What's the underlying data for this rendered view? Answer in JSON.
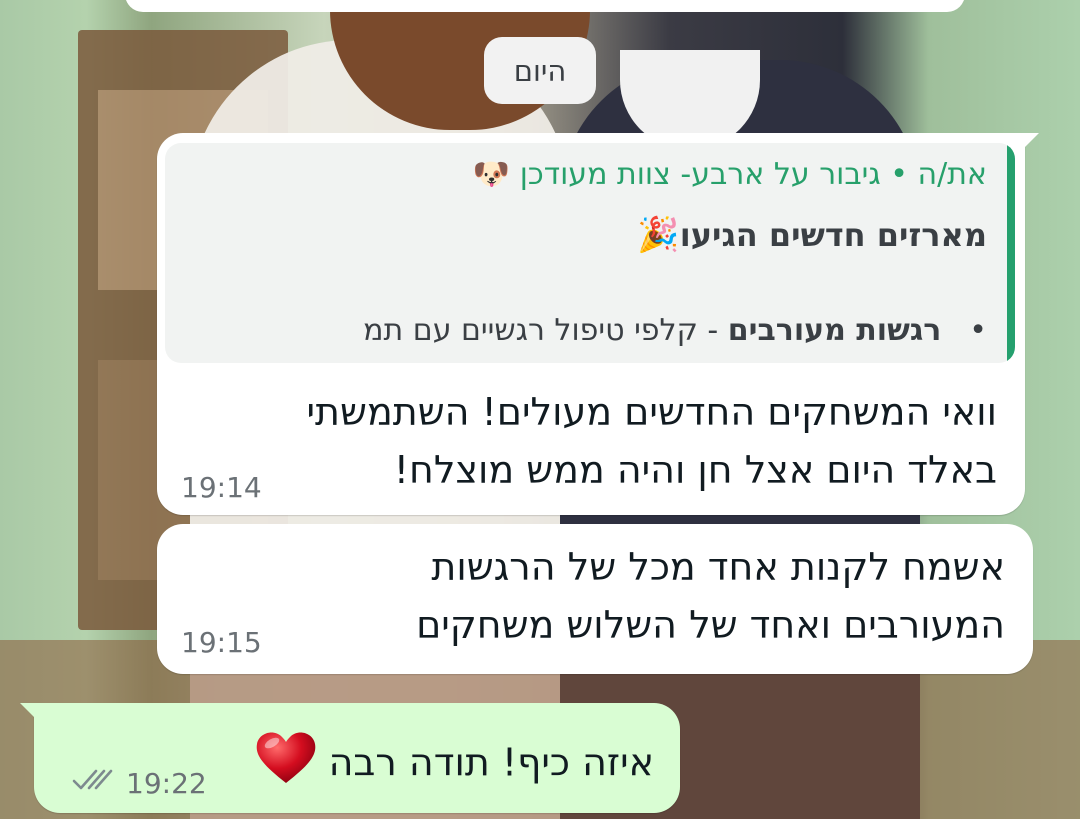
{
  "date_chip": "היום",
  "colors": {
    "accent_green": "#25a06e",
    "outgoing_bubble": "#d9fdd3",
    "incoming_bubble": "#ffffff"
  },
  "messages": [
    {
      "direction": "incoming",
      "quote": {
        "author": "את/ה • גיבור על ארבע- צוות מעודכן",
        "author_icon": "dog-face-icon",
        "title": "מארזים חדשים הגיעו",
        "title_icon": "party-popper-icon",
        "bullet": "•",
        "line_bold": "רגשות מעורבים",
        "line_rest": " - קלפי טיפול רגשיים עם תמ"
      },
      "lines": [
        "וואי המשחקים החדשים מעולים! השתמשתי",
        "באלד היום אצל חן והיה ממש מוצלח!"
      ],
      "time": "19:14"
    },
    {
      "direction": "incoming",
      "lines": [
        "אשמח לקנות אחד מכל של הרגשות",
        "המעורבים ואחד של השלוש משחקים"
      ],
      "time": "19:15"
    },
    {
      "direction": "outgoing",
      "text": "איזה כיף! תודה רבה",
      "emoji": "red-heart-icon",
      "time": "19:22",
      "status_icon": "double-check-icon"
    }
  ]
}
